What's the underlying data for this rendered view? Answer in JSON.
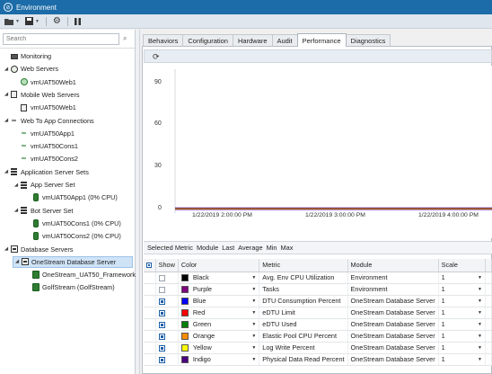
{
  "window": {
    "title": "Environment"
  },
  "search": {
    "placeholder": "Search"
  },
  "tree": [
    {
      "label": "Monitoring",
      "icon": "monitor-icon",
      "level": 0,
      "expander": ""
    },
    {
      "label": "Web Servers",
      "icon": "globe-icon",
      "level": 0,
      "expander": "◢"
    },
    {
      "label": "vmUAT50Web1",
      "icon": "globe-green-icon",
      "level": 1,
      "expander": ""
    },
    {
      "label": "Mobile Web Servers",
      "icon": "mobile-server-icon",
      "level": 0,
      "expander": "◢"
    },
    {
      "label": "vmUAT50Web1",
      "icon": "mobile-server-icon",
      "level": 1,
      "expander": ""
    },
    {
      "label": "Web To App Connections",
      "icon": "link-icon",
      "level": 0,
      "expander": "◢"
    },
    {
      "label": "vmUAT50App1",
      "icon": "link-green-icon",
      "level": 1,
      "expander": ""
    },
    {
      "label": "vmUAT50Cons1",
      "icon": "link-green-icon",
      "level": 1,
      "expander": ""
    },
    {
      "label": "vmUAT50Cons2",
      "icon": "link-green-icon",
      "level": 1,
      "expander": ""
    },
    {
      "label": "Application Server Sets",
      "icon": "server-set-icon",
      "level": 0,
      "expander": "◢"
    },
    {
      "label": "App Server Set",
      "icon": "server-set-icon",
      "level": 1,
      "expander": "◢"
    },
    {
      "label": "vmUAT50App1 (0% CPU)",
      "icon": "app-server-icon",
      "level": 2,
      "expander": ""
    },
    {
      "label": "Bot Server Set",
      "icon": "server-set-icon",
      "level": 1,
      "expander": "◢"
    },
    {
      "label": "vmUAT50Cons1 (0% CPU)",
      "icon": "app-server-icon",
      "level": 2,
      "expander": ""
    },
    {
      "label": "vmUAT50Cons2 (0% CPU)",
      "icon": "app-server-icon",
      "level": 2,
      "expander": ""
    },
    {
      "label": "Database Servers",
      "icon": "database-server-icon",
      "level": 0,
      "expander": "◢"
    },
    {
      "label": "OneStream Database Server",
      "icon": "database-server-icon",
      "level": 1,
      "expander": "◢",
      "selected": true
    },
    {
      "label": "OneStream_UAT50_Framework",
      "icon": "database-icon",
      "level": 2,
      "expander": ""
    },
    {
      "label": "GolfStream (GolfStream)",
      "icon": "database-icon",
      "level": 2,
      "expander": ""
    }
  ],
  "tabs": [
    "Behaviors",
    "Configuration",
    "Hardware",
    "Audit",
    "Performance",
    "Diagnostics"
  ],
  "active_tab": "Performance",
  "chart_data": {
    "type": "line",
    "y_ticks": [
      "90",
      "60",
      "30",
      "0"
    ],
    "ylim": [
      0,
      100
    ],
    "x_ticks": [
      "1/22/2019 2:00:00 PM",
      "1/22/2019 3:00:00 PM",
      "1/22/2019 4:00:00 PM"
    ],
    "series": [
      {
        "name": "DTU Consumption Percent",
        "color": "#0000ff",
        "values": [
          0,
          0
        ]
      },
      {
        "name": "eDTU Limit",
        "color": "#ff0000",
        "values": [
          0,
          0
        ]
      },
      {
        "name": "eDTU Used",
        "color": "#008000",
        "values": [
          0,
          0
        ]
      },
      {
        "name": "Elastic Pool CPU Percent",
        "color": "#ff8c00",
        "values": [
          0,
          0
        ]
      },
      {
        "name": "Log Write Percent",
        "color": "#ffff00",
        "values": [
          0,
          0
        ]
      },
      {
        "name": "Physical Data Read Percent",
        "color": "#4b0082",
        "values": [
          0,
          0
        ]
      }
    ]
  },
  "stats_headers": [
    "Selected Metric",
    "Module",
    "Last",
    "Average",
    "Min",
    "Max"
  ],
  "grid": {
    "headers": [
      "Show",
      "Color",
      "Metric",
      "Module",
      "Scale"
    ],
    "rows": [
      {
        "show": false,
        "color_name": "Black",
        "color": "#000000",
        "metric": "Avg. Env CPU Utilization",
        "module": "Environment",
        "scale": "1"
      },
      {
        "show": false,
        "color_name": "Purple",
        "color": "#800080",
        "metric": "Tasks",
        "module": "Environment",
        "scale": "1"
      },
      {
        "show": true,
        "color_name": "Blue",
        "color": "#0000ff",
        "metric": "DTU Consumption Percent",
        "module": "OneStream Database Server",
        "scale": "1"
      },
      {
        "show": true,
        "color_name": "Red",
        "color": "#ff0000",
        "metric": "eDTU Limit",
        "module": "OneStream Database Server",
        "scale": "1"
      },
      {
        "show": true,
        "color_name": "Green",
        "color": "#008000",
        "metric": "eDTU Used",
        "module": "OneStream Database Server",
        "scale": "1"
      },
      {
        "show": true,
        "color_name": "Orange",
        "color": "#ff8c00",
        "metric": "Elastic Pool CPU Percent",
        "module": "OneStream Database Server",
        "scale": "1"
      },
      {
        "show": true,
        "color_name": "Yellow",
        "color": "#ffff00",
        "metric": "Log Write Percent",
        "module": "OneStream Database Server",
        "scale": "1"
      },
      {
        "show": true,
        "color_name": "Indigo",
        "color": "#4b0082",
        "metric": "Physical Data Read Percent",
        "module": "OneStream Database Server",
        "scale": "1"
      }
    ]
  }
}
